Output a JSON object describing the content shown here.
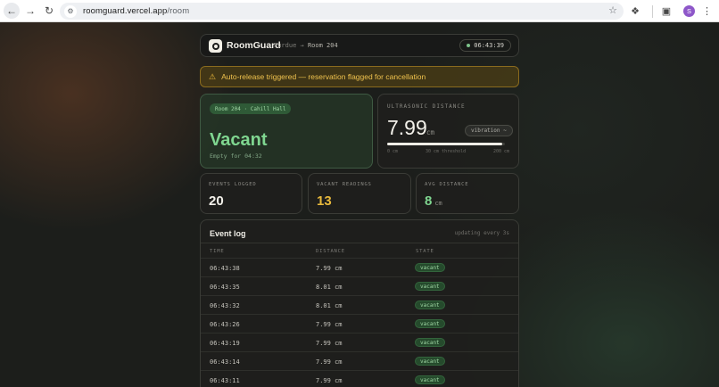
{
  "browser": {
    "url_host": "roomguard.vercel.app",
    "url_path": "/room",
    "profile_initial": "S"
  },
  "header": {
    "brand": "RoomGuard",
    "crumb_building": "Purdue →",
    "crumb_room": "Room 204",
    "clock": "06:43:39"
  },
  "alert": {
    "text": "Auto-release triggered — reservation flagged for cancellation"
  },
  "status": {
    "room_label": "Room 204 · Cahill Hall",
    "state": "Vacant",
    "empty_for": "Empty for 04:32"
  },
  "ultrasonic": {
    "label": "ULTRASONIC DISTANCE",
    "value": "7.99",
    "unit": "cm",
    "mode_button": "vibration ~",
    "fill_fraction": 0.98,
    "tick_min": "0 cm",
    "tick_threshold": "30 cm threshold",
    "tick_max": "200 cm"
  },
  "stats": {
    "events_label": "EVENTS LOGGED",
    "events_value": "20",
    "vacant_label": "VACANT READINGS",
    "vacant_value": "13",
    "avg_label": "AVG DISTANCE",
    "avg_value": "8",
    "avg_unit": "cm"
  },
  "log": {
    "title": "Event log",
    "subtitle": "updating every 3s",
    "columns": {
      "time": "TIME",
      "distance": "DISTANCE",
      "state": "STATE"
    },
    "rows": [
      {
        "time": "06:43:38",
        "distance": "7.99 cm",
        "state": "vacant"
      },
      {
        "time": "06:43:35",
        "distance": "8.01 cm",
        "state": "vacant"
      },
      {
        "time": "06:43:32",
        "distance": "8.01 cm",
        "state": "vacant"
      },
      {
        "time": "06:43:26",
        "distance": "7.99 cm",
        "state": "vacant"
      },
      {
        "time": "06:43:19",
        "distance": "7.99 cm",
        "state": "vacant"
      },
      {
        "time": "06:43:14",
        "distance": "7.99 cm",
        "state": "vacant"
      },
      {
        "time": "06:43:11",
        "distance": "7.99 cm",
        "state": "vacant"
      }
    ]
  },
  "colors": {
    "accent_green": "#7fd690",
    "accent_yellow": "#e8b93c",
    "alert_text": "#f1c34e"
  }
}
